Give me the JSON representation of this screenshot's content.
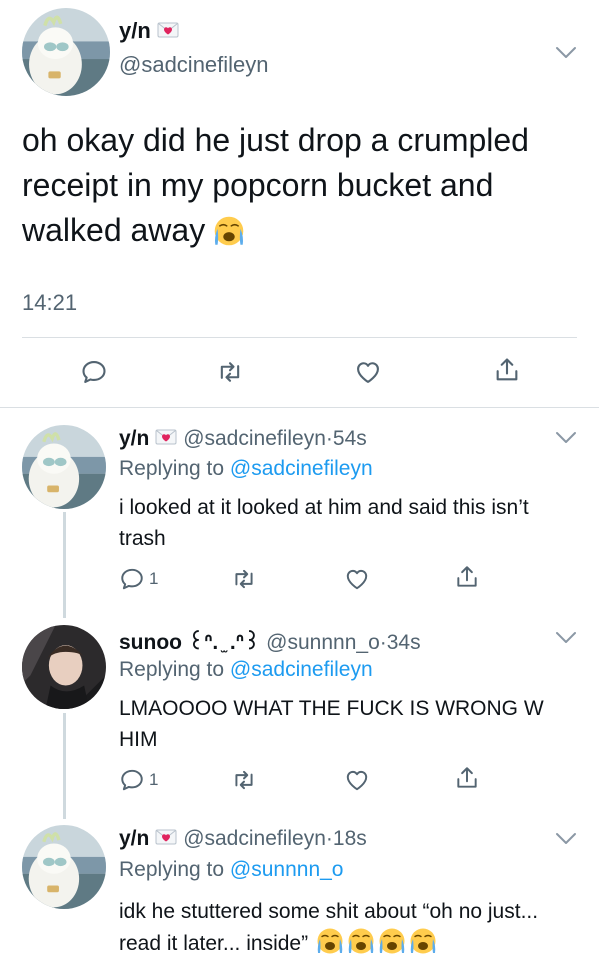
{
  "main_tweet": {
    "display_name": "y/n",
    "handle": "@sadcinefileyn",
    "text": "oh okay did he just drop a crumpled receipt in my popcorn bucket and walked away",
    "emoji": "loudly-crying-face-icon",
    "time": "14:21"
  },
  "replies": [
    {
      "display_name": "y/n",
      "handle": "@sadcinefileyn",
      "sep": "·",
      "age": "54s",
      "replying_prefix": "Replying to",
      "replying_to": "@sadcinefileyn",
      "text": "i looked at it looked at him and said this isn’t trash",
      "reply_count": "1"
    },
    {
      "display_name": "sunoo ꒰ᐢ. ̫ .ᐢ꒱",
      "handle": "@sunnnn_o",
      "sep": "·",
      "age": "34s",
      "replying_prefix": "Replying to",
      "replying_to": "@sadcinefileyn",
      "text": "LMAOOOO WHAT THE FUCK IS WRONG W HIM",
      "reply_count": "1"
    },
    {
      "display_name": "y/n",
      "handle": "@sadcinefileyn",
      "sep": "·",
      "age": "18s",
      "replying_prefix": "Replying to",
      "replying_to": "@sunnnn_o",
      "text": "idk he stuttered some shit about “oh no just... read it later... inside”"
    }
  ],
  "colors": {
    "text": "#0f1419",
    "secondary": "#536471",
    "link": "#1d9bf0",
    "divider": "#dadfe3",
    "heart_badge": "#e0245e"
  }
}
